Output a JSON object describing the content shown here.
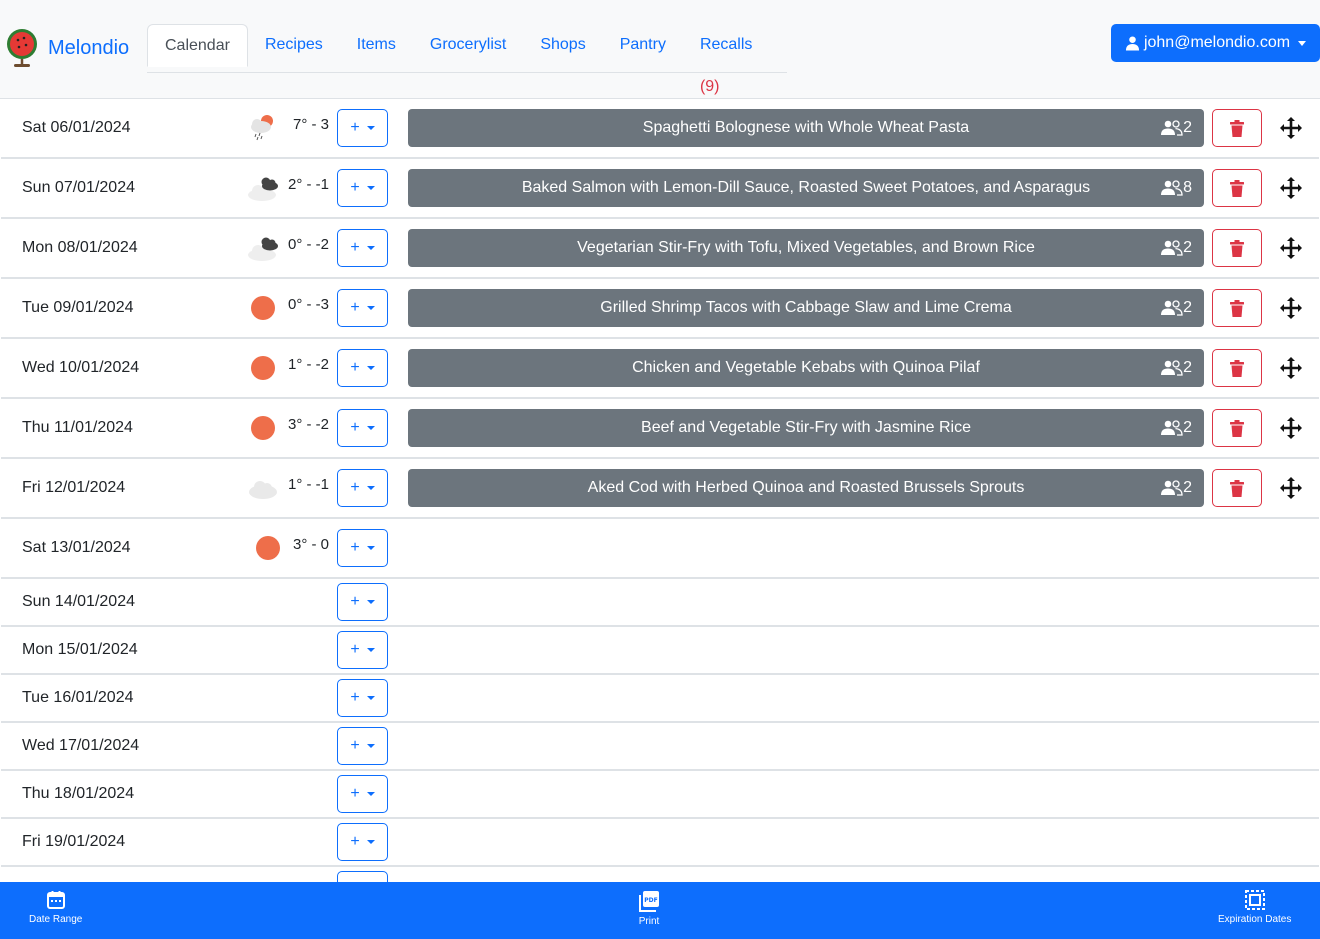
{
  "app": {
    "name": "Melondio"
  },
  "nav": {
    "tabs": [
      {
        "label": "Calendar",
        "active": true
      },
      {
        "label": "Recipes"
      },
      {
        "label": "Items"
      },
      {
        "label": "Grocerylist"
      },
      {
        "label": "Shops"
      },
      {
        "label": "Pantry"
      },
      {
        "label": "Recalls",
        "count": "(9)"
      }
    ]
  },
  "user": {
    "email": "john@melondio.com"
  },
  "calendar": {
    "add_label": "+",
    "days": [
      {
        "date": "Sat 06/01/2024",
        "weather": "sun-rain-icon",
        "temp": "7° - 3",
        "meal": "Spaghetti Bolognese with Whole Wheat Pasta",
        "people": "2"
      },
      {
        "date": "Sun 07/01/2024",
        "weather": "dark-cloud-icon",
        "temp": "2° - -1",
        "meal": "Baked Salmon with Lemon-Dill Sauce, Roasted Sweet Potatoes, and Asparagus",
        "people": "8"
      },
      {
        "date": "Mon 08/01/2024",
        "weather": "dark-cloud-icon",
        "temp": "0° - -2",
        "meal": "Vegetarian Stir-Fry with Tofu, Mixed Vegetables, and Brown Rice",
        "people": "2"
      },
      {
        "date": "Tue 09/01/2024",
        "weather": "sun-icon",
        "temp": "0° - -3",
        "meal": "Grilled Shrimp Tacos with Cabbage Slaw and Lime Crema",
        "people": "2"
      },
      {
        "date": "Wed 10/01/2024",
        "weather": "sun-icon",
        "temp": "1° - -2",
        "meal": "Chicken and Vegetable Kebabs with Quinoa Pilaf",
        "people": "2"
      },
      {
        "date": "Thu 11/01/2024",
        "weather": "sun-icon",
        "temp": "3° - -2",
        "meal": "Beef and Vegetable Stir-Fry with Jasmine Rice",
        "people": "2"
      },
      {
        "date": "Fri 12/01/2024",
        "weather": "light-cloud-icon",
        "temp": "1° - -1",
        "meal": "Aked Cod with Herbed Quinoa and Roasted Brussels Sprouts",
        "people": "2"
      },
      {
        "date": "Sat 13/01/2024",
        "weather": "sun-icon",
        "temp": "3° - 0"
      },
      {
        "date": "Sun 14/01/2024"
      },
      {
        "date": "Mon 15/01/2024"
      },
      {
        "date": "Tue 16/01/2024"
      },
      {
        "date": "Wed 17/01/2024"
      },
      {
        "date": "Thu 18/01/2024"
      },
      {
        "date": "Fri 19/01/2024"
      },
      {
        "date": ""
      }
    ]
  },
  "footer": {
    "date_range": "Date Range",
    "print": "Print",
    "expiration": "Expiration Dates"
  },
  "colors": {
    "primary": "#0d6efd",
    "danger": "#dc3545",
    "meal_bg": "#6c757d",
    "sun": "#ee6e4a"
  }
}
